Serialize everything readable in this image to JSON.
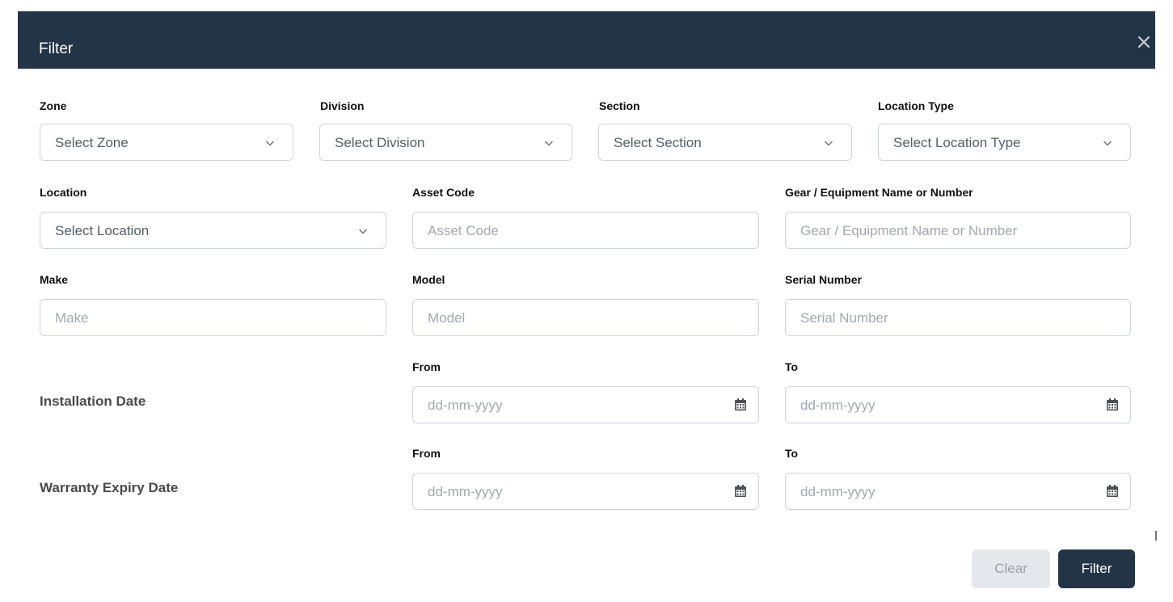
{
  "modal": {
    "title": "Filter",
    "close_icon": "close-icon"
  },
  "filters": {
    "zone": {
      "label": "Zone",
      "placeholder": "Select Zone"
    },
    "division": {
      "label": "Division",
      "placeholder": "Select Division"
    },
    "section": {
      "label": "Section",
      "placeholder": "Select Section"
    },
    "location_type": {
      "label": "Location Type",
      "placeholder": "Select Location Type"
    },
    "location": {
      "label": "Location",
      "placeholder": "Select Location"
    },
    "asset_code": {
      "label": "Asset Code",
      "placeholder": "Asset Code"
    },
    "gear": {
      "label": "Gear / Equipment Name or Number",
      "placeholder": "Gear / Equipment Name or Number"
    },
    "make": {
      "label": "Make",
      "placeholder": "Make"
    },
    "model": {
      "label": "Model",
      "placeholder": "Model"
    },
    "serial_number": {
      "label": "Serial Number",
      "placeholder": "Serial Number"
    }
  },
  "installation_date": {
    "label": "Installation Date",
    "from_label": "From",
    "to_label": "To",
    "from_placeholder": "dd-mm-yyyy",
    "to_placeholder": "dd-mm-yyyy"
  },
  "warranty_expiry_date": {
    "label": "Warranty Expiry Date",
    "from_label": "From",
    "to_label": "To",
    "from_placeholder": "dd-mm-yyyy",
    "to_placeholder": "dd-mm-yyyy"
  },
  "actions": {
    "clear_label": "Clear",
    "filter_label": "Filter"
  },
  "icons": {
    "dropdown": "chevron-down-icon",
    "date": "calendar-icon"
  },
  "colors": {
    "header_bg": "#243447",
    "primary_button": "#243447",
    "clear_button": "#e4e8ec",
    "input_border": "#ced4da"
  }
}
